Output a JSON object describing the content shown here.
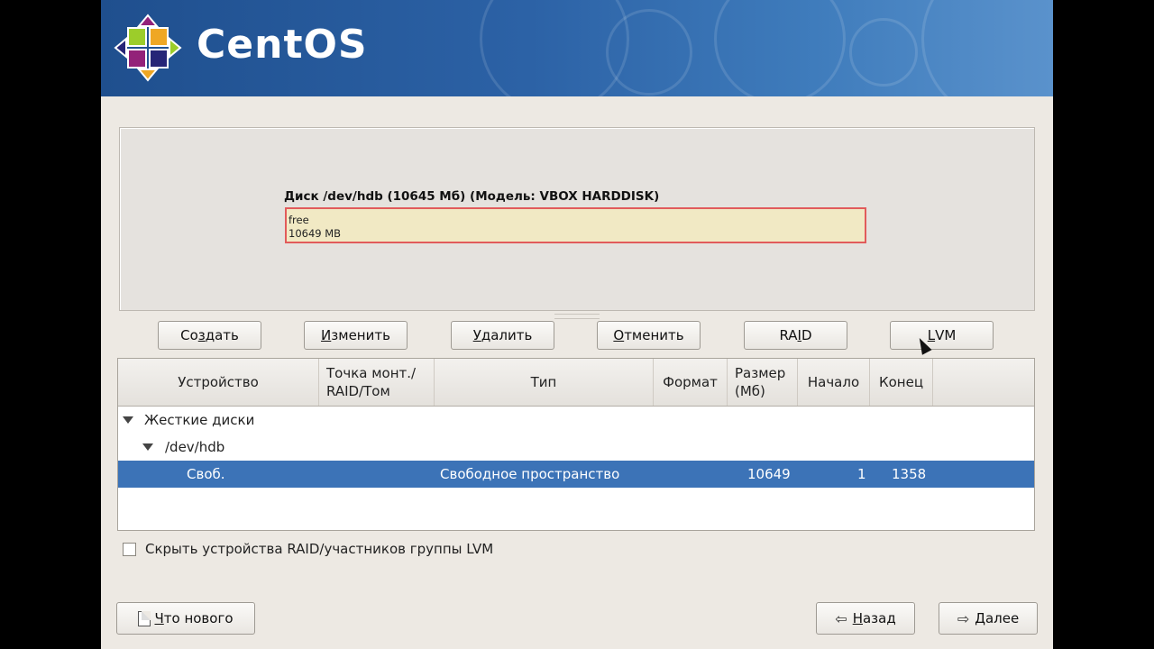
{
  "banner": {
    "logo_text": "CentOS"
  },
  "disk": {
    "title": "Диск /dev/hdb (10645 Мб) (Модель: VBOX HARDDISK)",
    "segment_label": "free",
    "segment_size": "10649 MB",
    "segment_border_color": "#e15b5b",
    "segment_fill_color": "#f1e9c4"
  },
  "actions": [
    {
      "label_pre": "Со",
      "label_u": "з",
      "label_post": "дать"
    },
    {
      "label_pre": "",
      "label_u": "И",
      "label_post": "зменить"
    },
    {
      "label_pre": "",
      "label_u": "У",
      "label_post": "далить"
    },
    {
      "label_pre": "",
      "label_u": "О",
      "label_post": "тменить"
    },
    {
      "label_pre": "RA",
      "label_u": "I",
      "label_post": "D"
    },
    {
      "label_pre": "",
      "label_u": "L",
      "label_post": "VM"
    }
  ],
  "table": {
    "columns": [
      "Устройство",
      "Точка монт./\nRAID/Том",
      "Тип",
      "Формат",
      "Размер\n(Мб)",
      "Начало",
      "Конец"
    ],
    "group": "Жесткие диски",
    "device": "/dev/hdb",
    "row": {
      "device": "Своб.",
      "type": "Свободное пространство",
      "size": "10649",
      "start": "1",
      "end": "1358"
    },
    "selection_color": "#3c73b7"
  },
  "options": {
    "hide_raid_label": "Скрыть устройства RAID/участников группы LVM",
    "hide_raid_checked": false
  },
  "footer": {
    "whats_new_pre": "",
    "whats_new_u": "Ч",
    "whats_new_post": "то нового",
    "back_pre": "",
    "back_u": "Н",
    "back_post": "азад",
    "next_pre": "",
    "next_u": "Д",
    "next_post": "алее"
  },
  "icons": [
    "centos-logo-icon",
    "document-icon",
    "arrow-left-icon",
    "arrow-right-icon",
    "expander-icon",
    "mouse-cursor-icon"
  ]
}
